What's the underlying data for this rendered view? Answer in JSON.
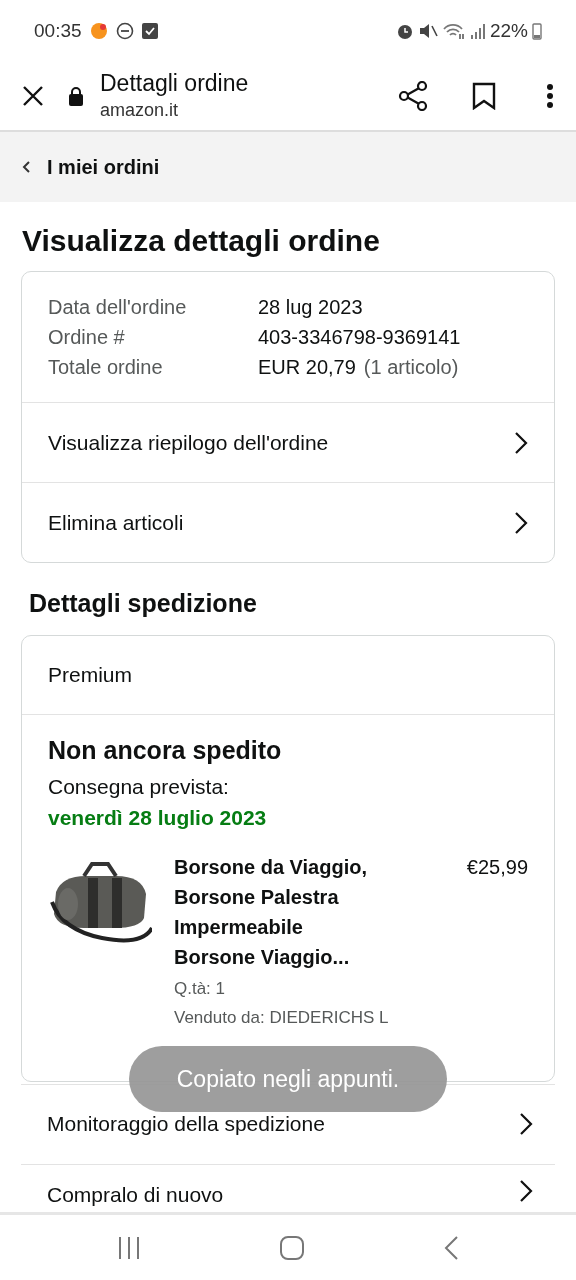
{
  "status_bar": {
    "time": "00:35",
    "battery": "22%"
  },
  "browser": {
    "title": "Dettagli ordine",
    "url": "amazon.it"
  },
  "breadcrumb": {
    "label": "I miei ordini"
  },
  "page_title": "Visualizza dettagli ordine",
  "order_summary": {
    "fields": [
      {
        "label": "Data dell'ordine",
        "value": "28 lug 2023"
      },
      {
        "label": "Ordine #",
        "value": "403-3346798-9369141"
      },
      {
        "label": "Totale ordine",
        "value": "EUR 20,79",
        "note": "(1 articolo)"
      }
    ],
    "links": [
      "Visualizza riepilogo dell'ordine",
      "Elimina articoli"
    ]
  },
  "shipping": {
    "heading": "Dettagli spedizione",
    "service": "Premium",
    "status": "Non ancora spedito",
    "delivery_label": "Consegna prevista:",
    "delivery_date": "venerdì 28 luglio 2023",
    "items": [
      {
        "title": "Borsone da Viaggio, Borsone Palestra Impermeabile Borsone Viaggio...",
        "price": "€25,99",
        "quantity": "Q.tà: 1",
        "seller": "Venduto da: DIEDERICHS L"
      }
    ]
  },
  "actions": [
    "Monitoraggio della spedizione",
    "Compralo di nuovo"
  ],
  "toast": "Copiato negli appunti."
}
